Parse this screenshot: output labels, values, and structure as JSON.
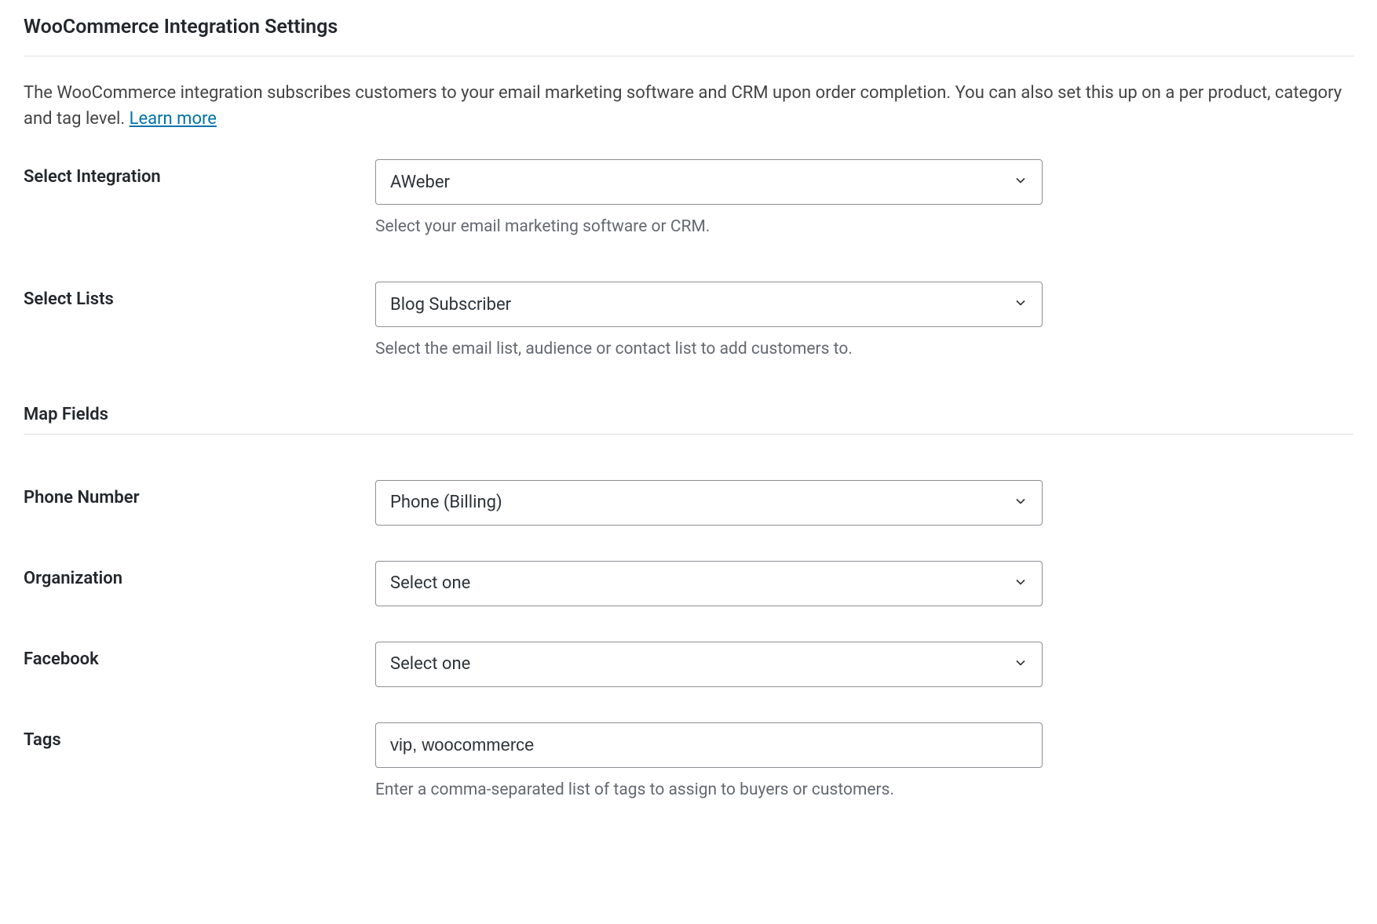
{
  "page": {
    "title": "WooCommerce Integration Settings",
    "description_text": "The WooCommerce integration subscribes customers to your email marketing software and CRM upon order completion. You can also set this up on a per product, category and tag level. ",
    "learn_more_label": "Learn more"
  },
  "fields": {
    "integration": {
      "label": "Select Integration",
      "value": "AWeber",
      "help": "Select your email marketing software or CRM."
    },
    "lists": {
      "label": "Select Lists",
      "value": "Blog Subscriber",
      "help": "Select the email list, audience or contact list to add customers to."
    },
    "map_fields_title": "Map Fields",
    "phone": {
      "label": "Phone Number",
      "value": "Phone (Billing)"
    },
    "organization": {
      "label": "Organization",
      "value": "Select one"
    },
    "facebook": {
      "label": "Facebook",
      "value": "Select one"
    },
    "tags": {
      "label": "Tags",
      "value": "vip, woocommerce",
      "help": "Enter a comma-separated list of tags to assign to buyers or customers."
    }
  }
}
